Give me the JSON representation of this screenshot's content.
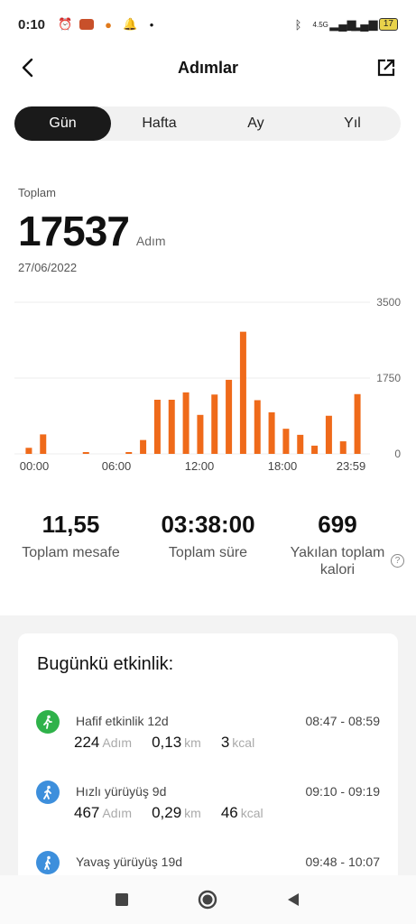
{
  "status_bar": {
    "time": "0:10",
    "battery": "17",
    "network": "4.5G"
  },
  "header": {
    "title": "Adımlar"
  },
  "tabs": [
    {
      "label": "Gün",
      "active": true
    },
    {
      "label": "Hafta",
      "active": false
    },
    {
      "label": "Ay",
      "active": false
    },
    {
      "label": "Yıl",
      "active": false
    }
  ],
  "summary": {
    "label": "Toplam",
    "value": "17537",
    "unit": "Adım",
    "date": "27/06/2022"
  },
  "chart_data": {
    "type": "bar",
    "x_ticks": [
      "00:00",
      "06:00",
      "12:00",
      "18:00",
      "23:59"
    ],
    "y_ticks": [
      "3500",
      "1750",
      "0"
    ],
    "ylim": [
      0,
      3500
    ],
    "color": "#ef6a1a",
    "values": [
      140,
      450,
      0,
      0,
      20,
      0,
      0,
      20,
      320,
      1250,
      1250,
      1420,
      900,
      1370,
      1710,
      2820,
      1240,
      960,
      580,
      440,
      190,
      880,
      290,
      1380
    ]
  },
  "stats": [
    {
      "value": "11,55",
      "label": "Toplam mesafe"
    },
    {
      "value": "03:38:00",
      "label": "Toplam süre"
    },
    {
      "value": "699",
      "label": "Yakılan toplam kalori"
    }
  ],
  "help_icon_text": "?",
  "activity": {
    "title": "Bugünkü etkinlik:",
    "items": [
      {
        "name": "Hafif etkinlik 12d",
        "time": "08:47 - 08:59",
        "steps": "224",
        "steps_unit": "Adım",
        "distance": "0,13",
        "distance_unit": "km",
        "kcal": "3",
        "kcal_unit": "kcal",
        "icon": "light-activity-icon",
        "color": "#2fb24a"
      },
      {
        "name": "Hızlı yürüyüş 9d",
        "time": "09:10 - 09:19",
        "steps": "467",
        "steps_unit": "Adım",
        "distance": "0,29",
        "distance_unit": "km",
        "kcal": "46",
        "kcal_unit": "kcal",
        "icon": "brisk-walk-icon",
        "color": "#3d8fdc"
      },
      {
        "name": "Yavaş yürüyüş 19d",
        "time": "09:48 - 10:07",
        "icon": "slow-walk-icon",
        "color": "#3d8fdc"
      }
    ]
  }
}
